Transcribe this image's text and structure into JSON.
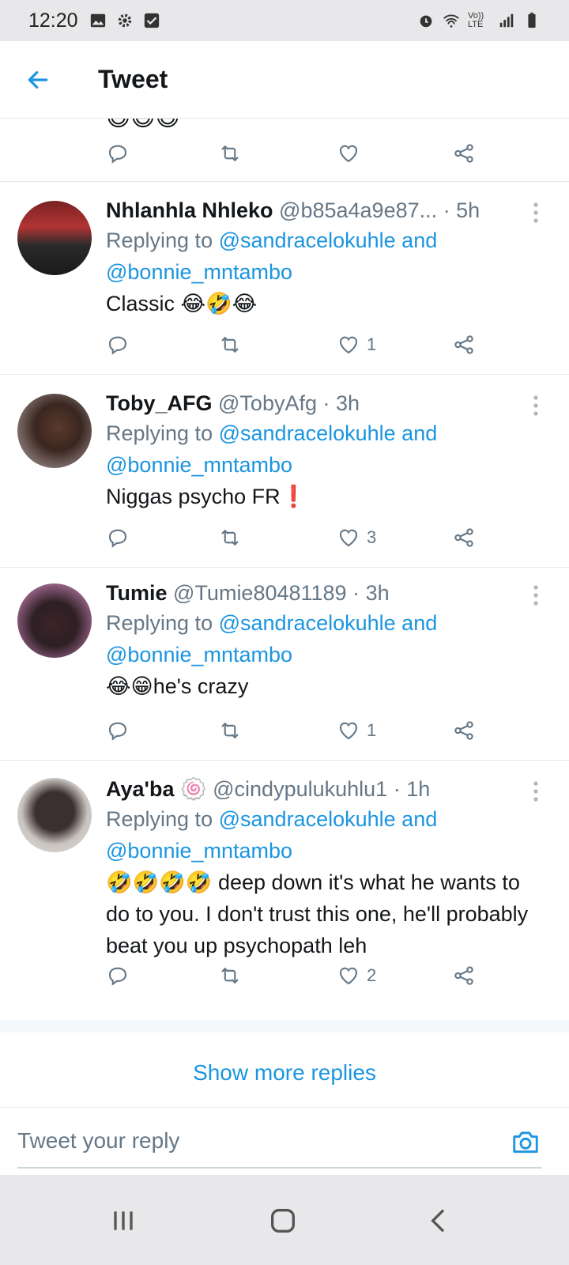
{
  "status_bar": {
    "time": "12:20",
    "lte_label": "Vo)) LTE"
  },
  "header": {
    "title": "Tweet"
  },
  "previous_tweet": {
    "emoji": "😅😅😅"
  },
  "tweets": [
    {
      "name": "Nhlanhla Nhleko",
      "handle": "@b85a4a9e87...",
      "sep": "·",
      "time": "5h",
      "replying_prefix": "Replying to",
      "mention1": "@sandracelokuhle",
      "and": "and",
      "mention2": "@bonnie_mntambo",
      "text": "Classic 😂🤣😂",
      "likes": "1",
      "avatar_colors": [
        "#7a2222",
        "#2a2a2a"
      ]
    },
    {
      "name": "Toby_AFG",
      "handle": "@TobyAfg",
      "sep": "·",
      "time": "3h",
      "replying_prefix": "Replying to",
      "mention1": "@sandracelokuhle",
      "and": "and",
      "mention2": "@bonnie_mntambo",
      "text": "Niggas psycho FR❗",
      "likes": "3",
      "avatar_colors": [
        "#6b4a3a",
        "#3a2620"
      ]
    },
    {
      "name": "Tumie",
      "handle": "@Tumie80481189",
      "sep": "·",
      "time": "3h",
      "replying_prefix": "Replying to",
      "mention1": "@sandracelokuhle",
      "and": "and",
      "mention2": "@bonnie_mntambo",
      "text": "😂😁he's crazy",
      "likes": "1",
      "avatar_colors": [
        "#8a5a7a",
        "#2d1f24"
      ]
    },
    {
      "name": "Aya'ba",
      "name_emoji": "🍥",
      "handle": "@cindypulukuhlu1",
      "sep": "·",
      "time": "1h",
      "replying_prefix": "Replying to",
      "mention1": "@sandracelokuhle",
      "and": "and",
      "mention2": "@bonnie_mntambo",
      "text": "🤣🤣🤣🤣 deep down it's what he wants to do to you. I don't trust this one, he'll probably beat you up psychopath leh",
      "likes": "2",
      "avatar_colors": [
        "#c9c4c0",
        "#3b3030"
      ]
    }
  ],
  "show_more": "Show more replies",
  "compose": {
    "placeholder": "Tweet your reply"
  },
  "colors": {
    "accent": "#1b95e0",
    "muted": "#657786",
    "divider": "#e1e8ed"
  }
}
